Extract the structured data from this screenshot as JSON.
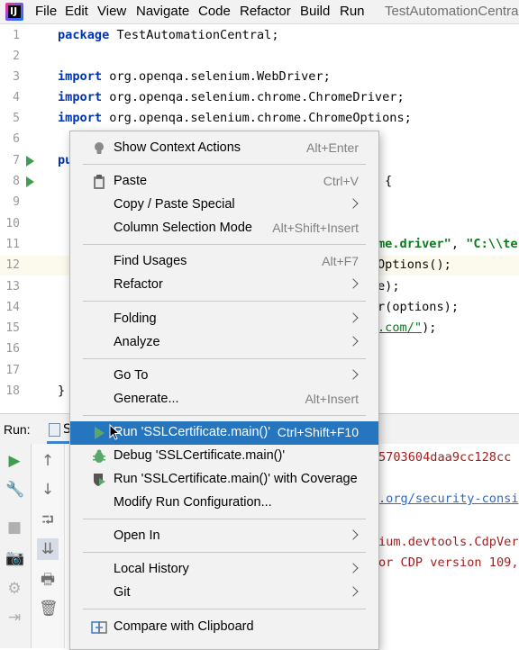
{
  "menubar": {
    "logo_letter": "IJ",
    "items": [
      "File",
      "Edit",
      "View",
      "Navigate",
      "Code",
      "Refactor",
      "Build",
      "Run"
    ],
    "window_title": "TestAutomationCentral"
  },
  "editor": {
    "line_numbers": [
      "1",
      "2",
      "3",
      "4",
      "5",
      "6",
      "7",
      "8",
      "9",
      "10",
      "11",
      "12",
      "13",
      "14",
      "15",
      "16",
      "17",
      "18"
    ],
    "lines": {
      "l1_kw": "package",
      "l1_rest": " TestAutomationCentral;",
      "l3_kw": "import",
      "l3_rest": " org.openqa.selenium.WebDriver;",
      "l4_kw": "import",
      "l4_rest": " org.openqa.selenium.chrome.ChromeDriver;",
      "l5_kw": "import",
      "l5_rest": " org.openqa.selenium.chrome.ChromeOptions;",
      "l7_visible": "pu",
      "l8_visible": "{",
      "l11_str1": "me.driver\"",
      "l11_sep": ", ",
      "l11_str2": "\"C:\\\\te",
      "l12_visible": "Options();",
      "l13_visible": "e);",
      "l14_visible": "r(options);",
      "l15_url": ".com/\"",
      "l15_rest": ");",
      "l18_visible": "}"
    }
  },
  "run_window": {
    "label": "Run:",
    "tab_text": "S",
    "console": {
      "line1": "5703604daa9cc128cc",
      "line2": ".org/security-consi",
      "line3": "ium.devtools.CdpVer",
      "line4": "or CDP version 109,"
    }
  },
  "context_menu": {
    "items": [
      {
        "label": "Show Context Actions",
        "shortcut": "Alt+Enter"
      },
      {
        "label": "Paste",
        "shortcut": "Ctrl+V"
      },
      {
        "label": "Copy / Paste Special",
        "shortcut": ""
      },
      {
        "label": "Column Selection Mode",
        "shortcut": "Alt+Shift+Insert"
      },
      {
        "label": "Find Usages",
        "shortcut": "Alt+F7"
      },
      {
        "label": "Refactor",
        "shortcut": ""
      },
      {
        "label": "Folding",
        "shortcut": ""
      },
      {
        "label": "Analyze",
        "shortcut": ""
      },
      {
        "label": "Go To",
        "shortcut": ""
      },
      {
        "label": "Generate...",
        "shortcut": "Alt+Insert"
      },
      {
        "label": "Run 'SSLCertificate.main()'",
        "shortcut": "Ctrl+Shift+F10"
      },
      {
        "label": "Debug 'SSLCertificate.main()'",
        "shortcut": ""
      },
      {
        "label": "Run 'SSLCertificate.main()' with Coverage",
        "shortcut": ""
      },
      {
        "label": "Modify Run Configuration...",
        "shortcut": ""
      },
      {
        "label": "Open In",
        "shortcut": ""
      },
      {
        "label": "Local History",
        "shortcut": ""
      },
      {
        "label": "Git",
        "shortcut": ""
      },
      {
        "label": "Compare with Clipboard",
        "shortcut": ""
      }
    ]
  },
  "colors": {
    "selection": "#2675bf",
    "keyword": "#0033b3",
    "string": "#067d17",
    "run_green": "#3f9d4f"
  }
}
